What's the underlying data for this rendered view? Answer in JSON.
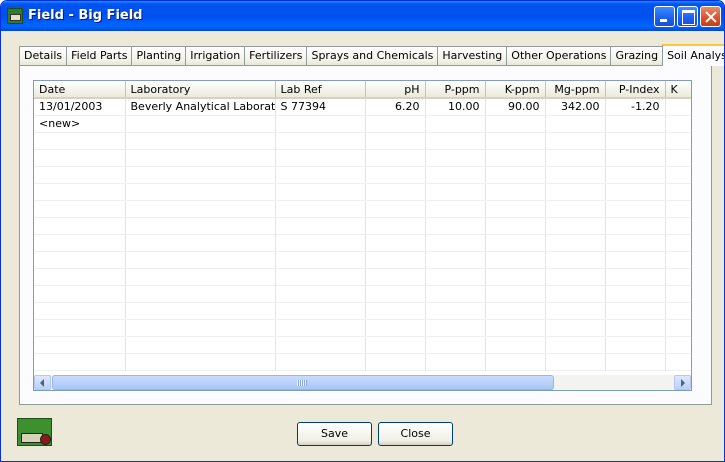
{
  "window": {
    "title": "Field - Big Field"
  },
  "tabs": [
    {
      "label": "Details",
      "active": false
    },
    {
      "label": "Field Parts",
      "active": false
    },
    {
      "label": "Planting",
      "active": false
    },
    {
      "label": "Irrigation",
      "active": false
    },
    {
      "label": "Fertilizers",
      "active": false
    },
    {
      "label": "Sprays and Chemicals",
      "active": false
    },
    {
      "label": "Harvesting",
      "active": false
    },
    {
      "label": "Other Operations",
      "active": false
    },
    {
      "label": "Grazing",
      "active": false
    },
    {
      "label": "Soil Analysis",
      "active": true
    }
  ],
  "grid": {
    "columns": [
      "Date",
      "Laboratory",
      "Lab Ref",
      "pH",
      "P-ppm",
      "K-ppm",
      "Mg-ppm",
      "P-Index",
      "K"
    ],
    "rows": [
      [
        "13/01/2003",
        "Beverly Analytical Laborato...",
        "S 77394",
        "6.20",
        "10.00",
        "90.00",
        "342.00",
        "-1.20",
        ""
      ],
      [
        "<new>",
        "",
        "",
        "",
        "",
        "",
        "",
        "",
        ""
      ]
    ]
  },
  "footer": {
    "save_label": "Save",
    "close_label": "Close"
  },
  "icons": {
    "app": "field-app-icon",
    "logo": "tractor-logo-icon"
  }
}
